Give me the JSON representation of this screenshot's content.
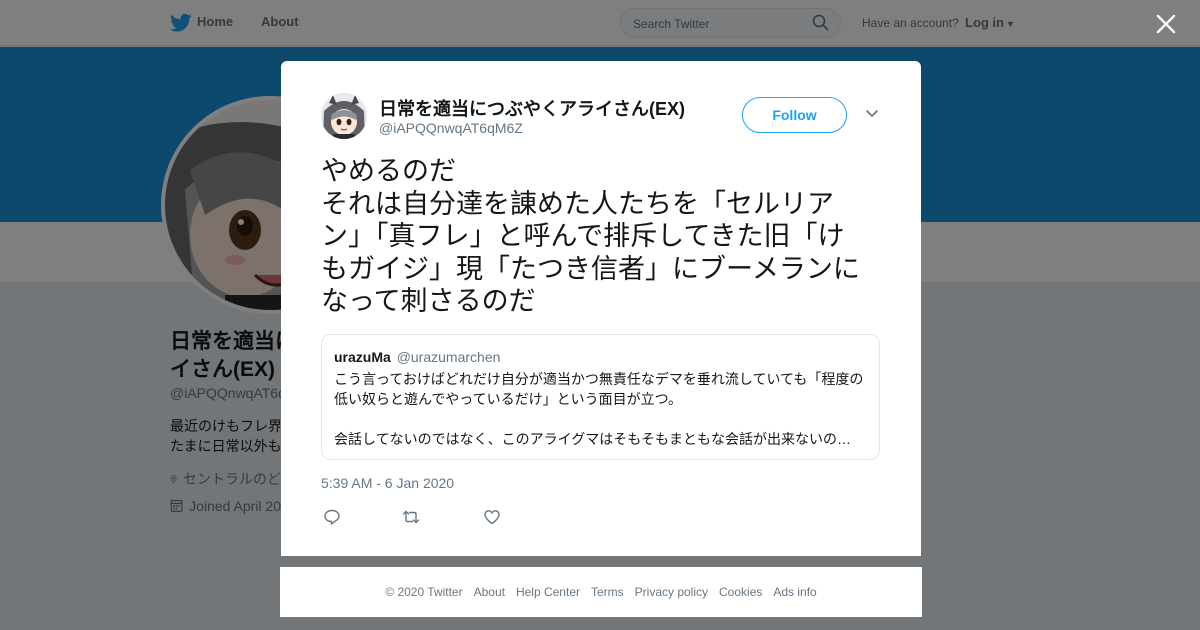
{
  "nav": {
    "home": "Home",
    "about": "About",
    "search_placeholder": "Search Twitter",
    "have_account": "Have an account?",
    "login": "Log in"
  },
  "profile": {
    "name_line1": "日常を適当に",
    "name_line2": "イさん(EX)",
    "handle": "@iAPQQnwqAT6q",
    "bio_line1": "最近のけもフレ界",
    "bio_line2": "たまに日常以外も",
    "location": "セントラルのど",
    "joined": "Joined April 20"
  },
  "tweet": {
    "author_name": "日常を適当につぶやくアライさん(EX)",
    "author_handle": "@iAPQQnwqAT6qM6Z",
    "follow_label": "Follow",
    "text": "やめるのだ\nそれは自分達を諌めた人たちを「セルリア\nン」「真フレ」と呼んで排斥してきた旧「け\nもガイジ」現「たつき信者」にブーメランに\nなって刺さるのだ",
    "quote": {
      "name": "urazuMa",
      "handle": "@urazumarchen",
      "text": "こう言っておけばどれだけ自分が適当かつ無責任なデマを垂れ流していても「程度の\n低い奴らと遊んでやっているだけ」という面目が立つ。\n\n会話してないのではなく、このアライグマはそもそもまともな会話が出来ないの…"
    },
    "timestamp": "5:39 AM - 6 Jan 2020"
  },
  "footer": {
    "links": [
      "© 2020 Twitter",
      "About",
      "Help Center",
      "Terms",
      "Privacy policy",
      "Cookies",
      "Ads info"
    ]
  },
  "colors": {
    "accent": "#1da1f2",
    "banner": "#1a91da",
    "muted": "#657786"
  }
}
